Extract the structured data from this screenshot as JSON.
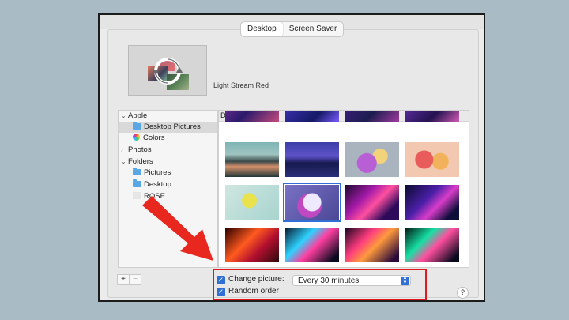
{
  "tabs": [
    {
      "label": "Desktop",
      "active": true
    },
    {
      "label": "Screen Saver",
      "active": false
    }
  ],
  "preview": {
    "background_name": "Light Stream Red"
  },
  "sidebar": {
    "items": [
      {
        "label": "Apple",
        "chevron": "v",
        "type": "group"
      },
      {
        "label": "Desktop Pictures",
        "type": "folder",
        "selected": true
      },
      {
        "label": "Colors",
        "type": "colors"
      },
      {
        "label": "Photos",
        "chevron": ">",
        "type": "group"
      },
      {
        "label": "Folders",
        "chevron": "v",
        "type": "group"
      },
      {
        "label": "Pictures",
        "type": "folder"
      },
      {
        "label": "Desktop",
        "type": "folder"
      },
      {
        "label": "ROSE",
        "type": "blank"
      }
    ]
  },
  "grid": {
    "header": "Desktop Pictures",
    "selected_index": 9
  },
  "controls": {
    "add_label": "+",
    "remove_label": "−",
    "change_picture_label": "Change picture:",
    "change_picture_checked": true,
    "interval_value": "Every 30 minutes",
    "random_order_label": "Random order",
    "random_order_checked": true,
    "checkmark": "✓",
    "help_label": "?"
  },
  "colors": {
    "highlight": "#e01a1a",
    "arrow": "#e8271e",
    "accent": "#2f6fd6",
    "background": "#a9bcc6"
  }
}
